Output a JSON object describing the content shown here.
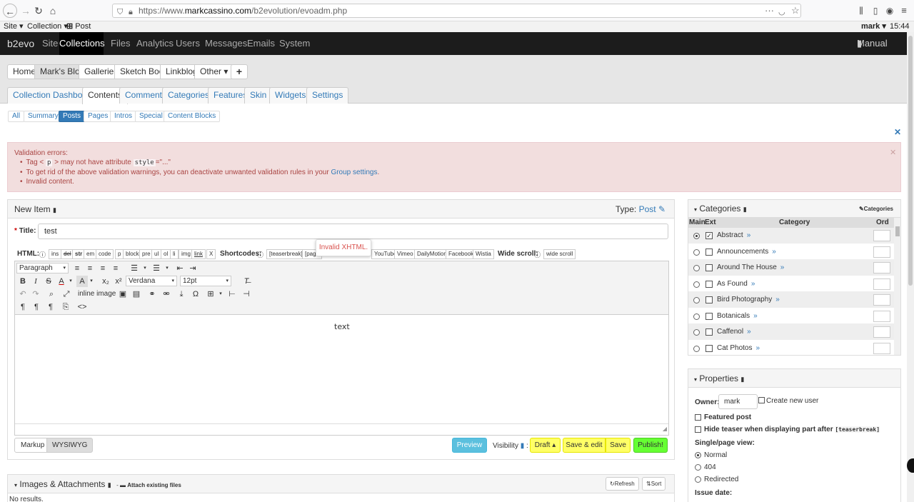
{
  "browser": {
    "url_prefix": "https://www.",
    "url_domain": "markcassino.com",
    "url_path": "/b2evolution/evoadm.php",
    "icons": [
      "back-arrow-icon",
      "forward-arrow-icon",
      "reload-icon",
      "home-icon",
      "shield-icon",
      "lock-icon",
      "more-icon",
      "pocket-icon",
      "star-icon",
      "library-icon",
      "sidebar-icon",
      "account-icon",
      "menu-icon"
    ]
  },
  "sitebar": {
    "site": "Site",
    "collection": "Collection",
    "post": "Post",
    "user": "mark",
    "time": "15:44"
  },
  "mainnav": {
    "brand": "b2evo",
    "site": "Site",
    "collections": "Collections",
    "files": "Files",
    "analytics": "Analytics",
    "users": "Users",
    "messages": "Messages",
    "emails": "Emails",
    "system": "System",
    "manual": "Manual page"
  },
  "collections": {
    "home": "Home",
    "marks_blog": "Mark's Blog",
    "galleries": "Galleries",
    "sketch_book": "Sketch Book",
    "linkblog": "Linkblog",
    "other": "Other",
    "add": "+"
  },
  "primary_tabs": {
    "dashboard": "Collection Dashboard",
    "contents": "Contents",
    "comments": "Comments",
    "categories": "Categories",
    "features": "Features",
    "skin": "Skin",
    "widgets": "Widgets",
    "settings": "Settings"
  },
  "sub_tabs": {
    "all": "All",
    "summary": "Summary",
    "posts": "Posts",
    "pages": "Pages",
    "intros": "Intros",
    "special": "Special",
    "content_blocks": "Content Blocks"
  },
  "errors": {
    "title": "Validation errors:",
    "tag_pre": "Tag <",
    "tag_code": "p",
    "tag_mid": "> may not have attribute",
    "attr_code": "style",
    "attr_post": "=\"...\"",
    "line2_pre": "To get rid of the above validation warnings, you can deactivate unwanted validation rules in your",
    "line2_link": "Group settings",
    "line2_post": ".",
    "line3": "Invalid content."
  },
  "editor": {
    "title": "New Item",
    "type_label": "Type:",
    "type_value": "Post",
    "title_label": "Title:",
    "title_value": "test",
    "html_label": "HTML:",
    "html_buttons": {
      "ins": "ins",
      "del": "del",
      "str": "str",
      "em": "em",
      "code": "code",
      "p": "p",
      "block": "block",
      "pre": "pre",
      "ul": "ul",
      "ol": "ol",
      "li": "li",
      "img": "img",
      "link": "link",
      "x": "X"
    },
    "shortcodes_label": "Shortcodes:",
    "teaserbreak": "[teaserbreak]",
    "pagebreak": "[page",
    "tooltip": "Invalid XHTML.",
    "embeds": {
      "youtube": "YouTube",
      "vimeo": "Vimeo",
      "dailymotion": "DailyMotion",
      "facebook": "Facebook",
      "wistia": "Wistia"
    },
    "widescroll_label": "Wide scroll:",
    "widescroll_btn": "wide scroll",
    "format": "Paragraph",
    "font": "Verdana",
    "size": "12pt",
    "inline_image": "inline image",
    "content": "text",
    "markup_tab": "Markup",
    "wysiwyg_tab": "WYSIWYG",
    "preview": "Preview",
    "visibility": "Visibility",
    "draft": "Draft",
    "save_edit": "Save & edit",
    "save": "Save",
    "publish": "Publish!"
  },
  "images": {
    "title": "Images & Attachments",
    "attach": "Attach existing files",
    "refresh": "Refresh",
    "sort": "Sort",
    "no_results": "No results."
  },
  "categories": {
    "title": "Categories",
    "link": "Categories",
    "col_main": "Main",
    "col_ext": "Ext",
    "col_category": "Category",
    "col_ord": "Ord",
    "rows": [
      {
        "name": "Abstract",
        "main": true,
        "ext": true
      },
      {
        "name": "Announcements",
        "main": false,
        "ext": false
      },
      {
        "name": "Around The House",
        "main": false,
        "ext": false
      },
      {
        "name": "As Found",
        "main": false,
        "ext": false
      },
      {
        "name": "Bird Photography",
        "main": false,
        "ext": false
      },
      {
        "name": "Botanicals",
        "main": false,
        "ext": false
      },
      {
        "name": "Caffenol",
        "main": false,
        "ext": false
      },
      {
        "name": "Cat Photos",
        "main": false,
        "ext": false
      }
    ],
    "arrow": "»"
  },
  "properties": {
    "title": "Properties",
    "owner_label": "Owner:",
    "owner_value": "mark",
    "create_new_user": "Create new user",
    "featured": "Featured post",
    "hide_teaser_pre": "Hide teaser when displaying part after",
    "hide_teaser_code": "[teaserbreak]",
    "single_page_view": "Single/page view:",
    "opt_normal": "Normal",
    "opt_404": "404",
    "opt_redirected": "Redirected",
    "issue_date": "Issue date:"
  },
  "colors": {
    "nav_bg": "#1c1c1c",
    "active_blue": "#337ab7",
    "error_bg": "#f2dede",
    "error_text": "#a94442",
    "preview": "#5bc0de",
    "draft": "#ffff66",
    "publish": "#66ff33"
  }
}
